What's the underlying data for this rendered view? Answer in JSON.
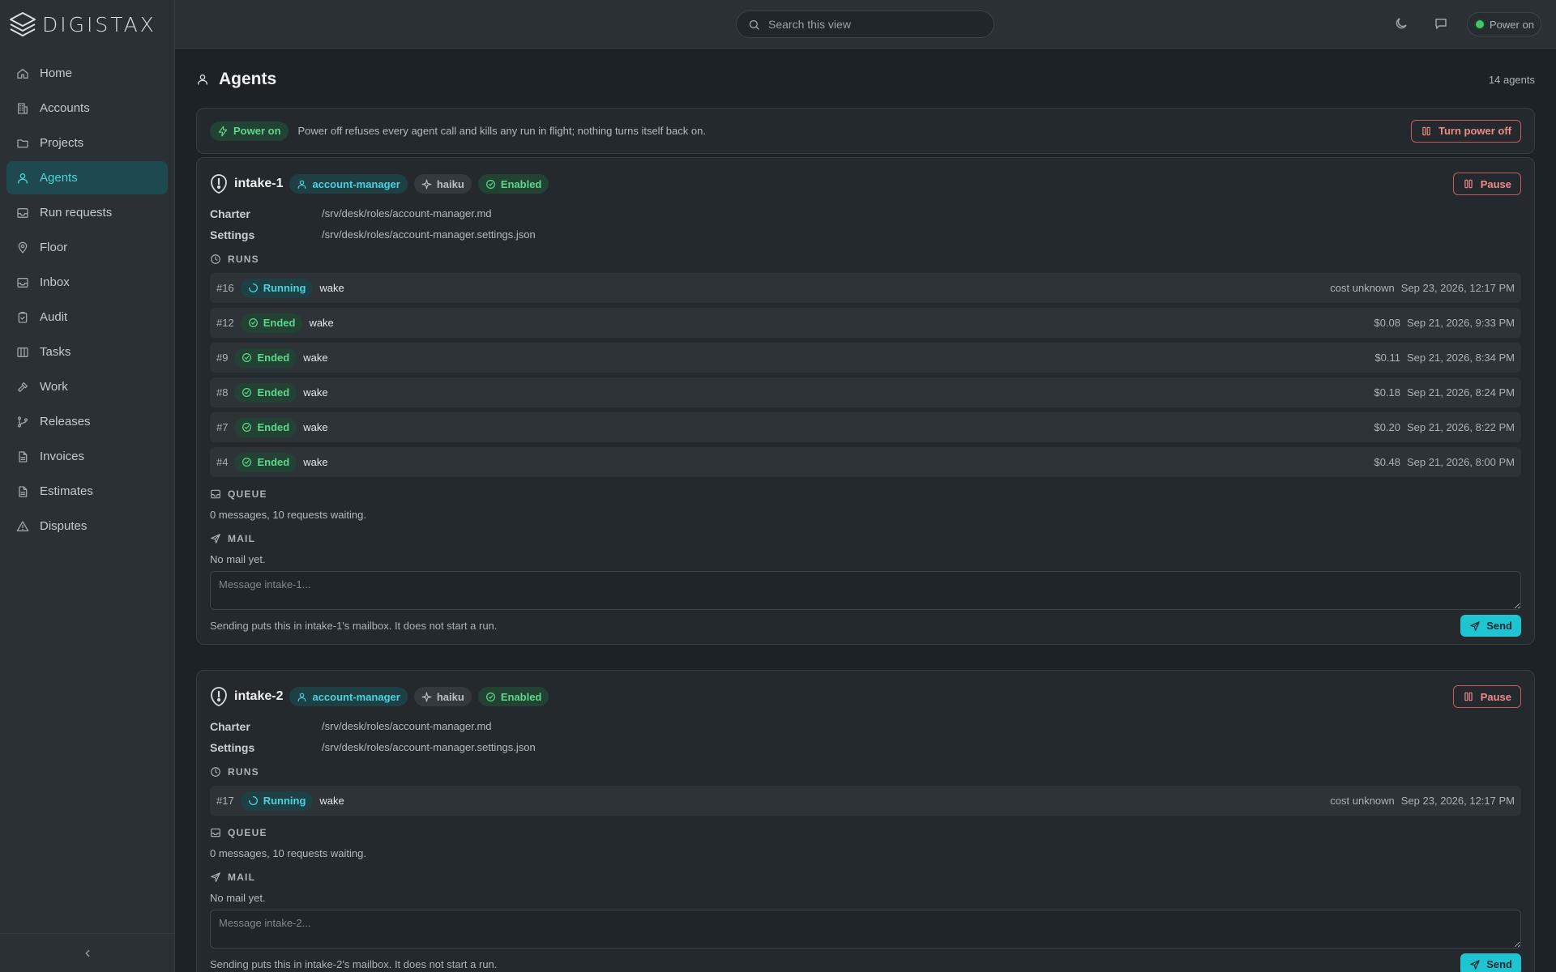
{
  "brand": {
    "name": "DIGISTAX"
  },
  "nav": [
    {
      "label": "Home",
      "icon": "home-icon"
    },
    {
      "label": "Accounts",
      "icon": "building-icon"
    },
    {
      "label": "Projects",
      "icon": "folder-icon"
    },
    {
      "label": "Agents",
      "icon": "user-icon",
      "active": true
    },
    {
      "label": "Run requests",
      "icon": "inbox-icon"
    },
    {
      "label": "Floor",
      "icon": "map-pin-icon"
    },
    {
      "label": "Inbox",
      "icon": "inbox-icon"
    },
    {
      "label": "Audit",
      "icon": "clipboard-icon"
    },
    {
      "label": "Tasks",
      "icon": "columns-icon"
    },
    {
      "label": "Work",
      "icon": "hammer-icon"
    },
    {
      "label": "Releases",
      "icon": "git-branch-icon"
    },
    {
      "label": "Invoices",
      "icon": "file-icon"
    },
    {
      "label": "Estimates",
      "icon": "file-icon"
    },
    {
      "label": "Disputes",
      "icon": "warning-icon"
    }
  ],
  "topbar": {
    "search_placeholder": "Search this view",
    "power_label": "Power on"
  },
  "page": {
    "title": "Agents",
    "count": "14 agents"
  },
  "power_banner": {
    "badge": "Power on",
    "text": "Power off refuses every agent call and kills any run in flight; nothing turns itself back on.",
    "button": "Turn power off"
  },
  "agents": [
    {
      "name": "intake-1",
      "role": "account-manager",
      "model": "haiku",
      "status": "Enabled",
      "pause_label": "Pause",
      "charter_label": "Charter",
      "charter": "/srv/desk/roles/account-manager.md",
      "settings_label": "Settings",
      "settings": "/srv/desk/roles/account-manager.settings.json",
      "runs_label": "RUNS",
      "runs": [
        {
          "num": "#16",
          "status": "Running",
          "kind": "wake",
          "cost": "cost unknown",
          "date": "Sep 23, 2026, 12:17 PM"
        },
        {
          "num": "#12",
          "status": "Ended",
          "kind": "wake",
          "cost": "$0.08",
          "date": "Sep 21, 2026, 9:33 PM"
        },
        {
          "num": "#9",
          "status": "Ended",
          "kind": "wake",
          "cost": "$0.11",
          "date": "Sep 21, 2026, 8:34 PM"
        },
        {
          "num": "#8",
          "status": "Ended",
          "kind": "wake",
          "cost": "$0.18",
          "date": "Sep 21, 2026, 8:24 PM"
        },
        {
          "num": "#7",
          "status": "Ended",
          "kind": "wake",
          "cost": "$0.20",
          "date": "Sep 21, 2026, 8:22 PM"
        },
        {
          "num": "#4",
          "status": "Ended",
          "kind": "wake",
          "cost": "$0.48",
          "date": "Sep 21, 2026, 8:00 PM"
        }
      ],
      "queue_label": "QUEUE",
      "queue_text": "0 messages, 10 requests waiting.",
      "mail_label": "MAIL",
      "mail_text": "No mail yet.",
      "message_placeholder": "Message intake-1...",
      "hint": "Sending puts this in intake-1's mailbox. It does not start a run.",
      "send_label": "Send"
    },
    {
      "name": "intake-2",
      "role": "account-manager",
      "model": "haiku",
      "status": "Enabled",
      "pause_label": "Pause",
      "charter_label": "Charter",
      "charter": "/srv/desk/roles/account-manager.md",
      "settings_label": "Settings",
      "settings": "/srv/desk/roles/account-manager.settings.json",
      "runs_label": "RUNS",
      "runs": [
        {
          "num": "#17",
          "status": "Running",
          "kind": "wake",
          "cost": "cost unknown",
          "date": "Sep 23, 2026, 12:17 PM"
        }
      ],
      "queue_label": "QUEUE",
      "queue_text": "0 messages, 10 requests waiting.",
      "mail_label": "MAIL",
      "mail_text": "No mail yet.",
      "message_placeholder": "Message intake-2...",
      "hint": "Sending puts this in intake-2's mailbox. It does not start a run.",
      "send_label": "Send"
    }
  ],
  "colors": {
    "accent": "#1fc4d2",
    "running": "#4cd2dc",
    "ended": "#5ed78a",
    "danger": "#ef8a8a"
  }
}
